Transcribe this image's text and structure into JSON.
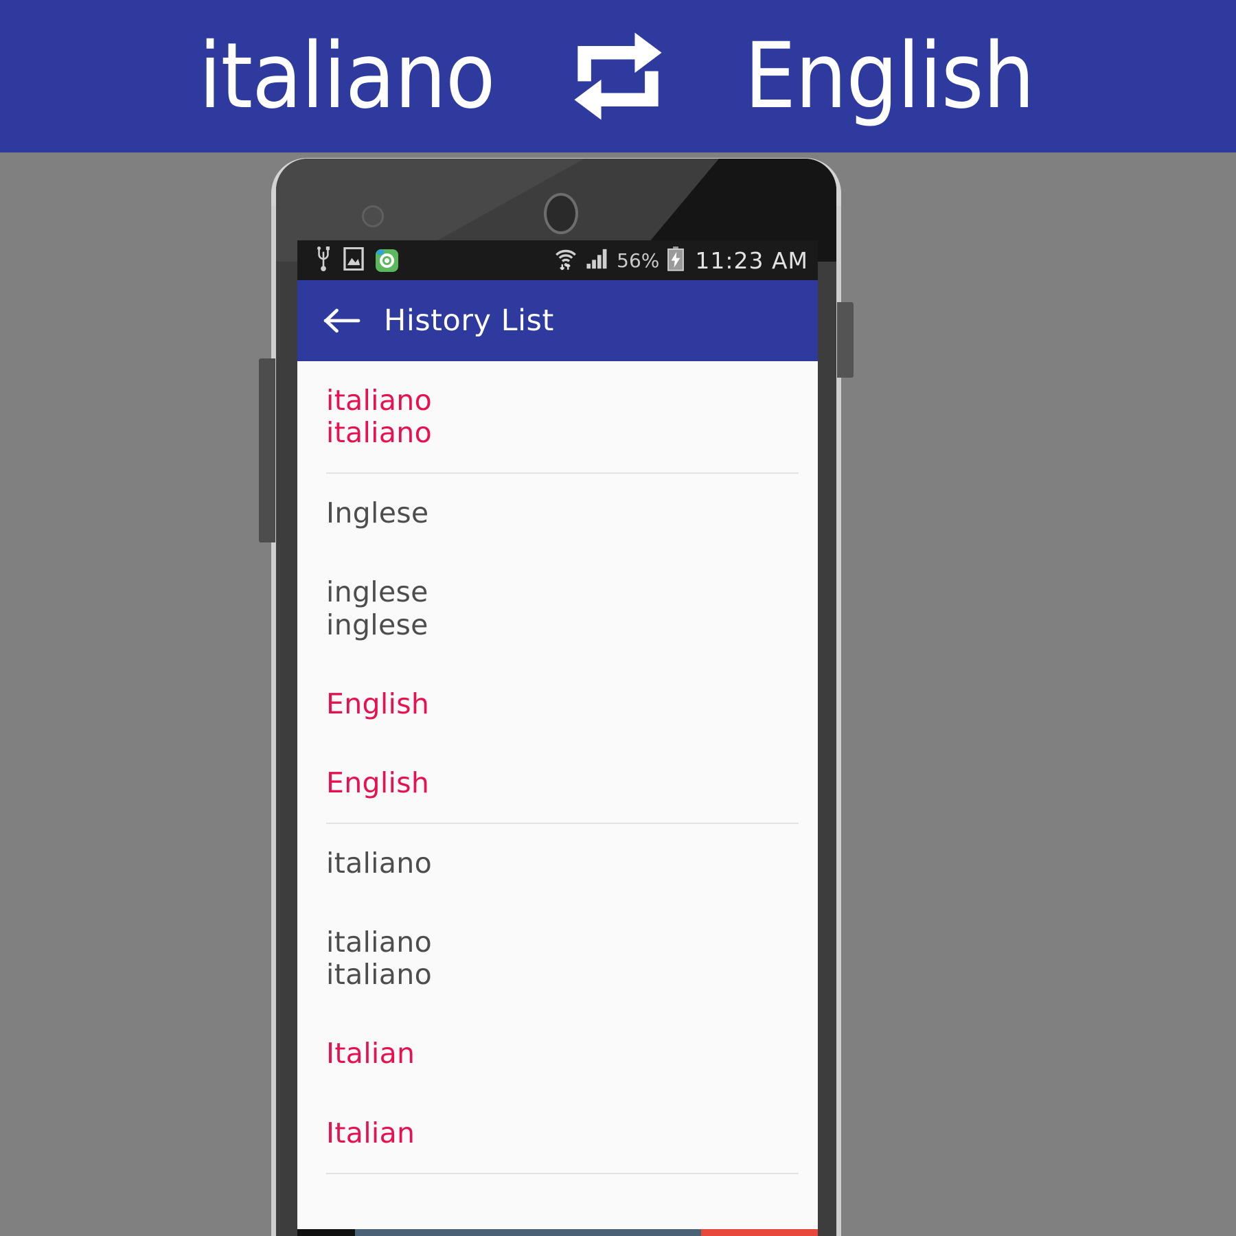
{
  "banner": {
    "source_language": "italiano",
    "target_language": "English",
    "swap_icon": "swap-repeat-icon",
    "background_color": "#2f3a9e",
    "text_color": "#ffffff"
  },
  "device": {
    "frame": "android-phone-mockup",
    "sensor_icon": "proximity-sensor",
    "camera_icon": "front-camera",
    "volume_button": "volume-rocker",
    "power_button": "power-button"
  },
  "statusbar": {
    "left_icons": [
      "usb-icon",
      "screenshot-image-icon",
      "green-app-icon"
    ],
    "right_icons": [
      "wifi-icon",
      "cellular-signal-icon",
      "battery-charging-icon"
    ],
    "battery_percent": "56%",
    "time": "11:23 AM"
  },
  "appbar": {
    "back_icon": "back-arrow-icon",
    "title": "History List",
    "background_color": "#2f3a9e"
  },
  "colors": {
    "accent_red": "#e8114f",
    "body_gray": "#4d4d4d",
    "brand_blue": "#2f3a9e",
    "page_background": "#808080"
  },
  "history": {
    "groups": [
      {
        "rows": [
          {
            "lines": [
              "italiano",
              "italiano"
            ],
            "color": "red"
          }
        ]
      },
      {
        "rows": [
          {
            "lines": [
              "Inglese"
            ],
            "color": "gray"
          },
          {
            "lines": [
              "inglese",
              "inglese"
            ],
            "color": "gray"
          },
          {
            "lines": [
              "English"
            ],
            "color": "red"
          },
          {
            "lines": [
              "English"
            ],
            "color": "red"
          }
        ]
      },
      {
        "rows": [
          {
            "lines": [
              "italiano"
            ],
            "color": "gray"
          },
          {
            "lines": [
              "italiano",
              "italiano"
            ],
            "color": "gray"
          },
          {
            "lines": [
              "Italian"
            ],
            "color": "red"
          },
          {
            "lines": [
              "Italian"
            ],
            "color": "red"
          }
        ]
      }
    ]
  }
}
